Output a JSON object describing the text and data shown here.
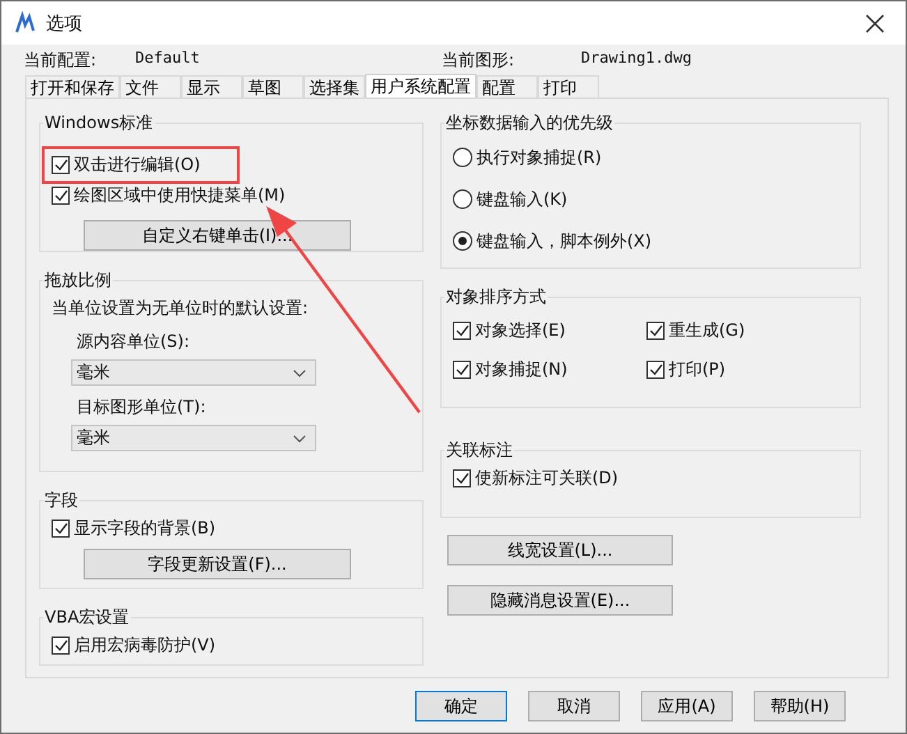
{
  "window": {
    "title": "选项"
  },
  "info": [
    {
      "label": "当前配置:",
      "value": "Default"
    },
    {
      "label": "当前图形:",
      "value": "Drawing1.dwg"
    }
  ],
  "tabs": [
    {
      "label": "打开和保存",
      "selected": false
    },
    {
      "label": "文件",
      "selected": false
    },
    {
      "label": "显示",
      "selected": false
    },
    {
      "label": "草图",
      "selected": false
    },
    {
      "label": "选择集",
      "selected": false
    },
    {
      "label": "用户系统配置",
      "selected": true
    },
    {
      "label": "配置",
      "selected": false
    },
    {
      "label": "打印",
      "selected": false
    }
  ],
  "columns": [
    {
      "groups": [
        {
          "title": "Windows标准",
          "items": [
            {
              "kind": "checkbox",
              "label": "双击进行编辑(O)",
              "checked": true
            },
            {
              "kind": "checkbox",
              "label": "绘图区域中使用快捷菜单(M)",
              "checked": true
            },
            {
              "kind": "button",
              "label": "自定义右键单击(I)..."
            }
          ]
        },
        {
          "title": "拖放比例",
          "items": [
            {
              "kind": "text",
              "label": "当单位设置为无单位时的默认设置:"
            },
            {
              "kind": "sublabel",
              "label": "源内容单位(S):"
            },
            {
              "kind": "select",
              "value": "毫米"
            },
            {
              "kind": "sublabel",
              "label": "目标图形单位(T):"
            },
            {
              "kind": "select",
              "value": "毫米"
            }
          ]
        },
        {
          "title": "字段",
          "items": [
            {
              "kind": "checkbox",
              "label": "显示字段的背景(B)",
              "checked": true
            },
            {
              "kind": "button",
              "label": "字段更新设置(F)..."
            }
          ]
        },
        {
          "title": "VBA宏设置",
          "items": [
            {
              "kind": "checkbox",
              "label": "启用宏病毒防护(V)",
              "checked": true
            }
          ]
        }
      ]
    },
    {
      "groups": [
        {
          "title": "坐标数据输入的优先级",
          "items": [
            {
              "kind": "radio",
              "label": "执行对象捕捉(R)",
              "selected": false
            },
            {
              "kind": "radio",
              "label": "键盘输入(K)",
              "selected": false
            },
            {
              "kind": "radio",
              "label": "键盘输入，脚本例外(X)",
              "selected": true
            }
          ]
        },
        {
          "title": "对象排序方式",
          "two_column": true,
          "items": [
            {
              "kind": "checkbox",
              "label": "对象选择(E)",
              "checked": true
            },
            {
              "kind": "checkbox",
              "label": "重生成(G)",
              "checked": true
            },
            {
              "kind": "checkbox",
              "label": "对象捕捉(N)",
              "checked": true
            },
            {
              "kind": "checkbox",
              "label": "打印(P)",
              "checked": true
            }
          ]
        },
        {
          "title": "关联标注",
          "items": [
            {
              "kind": "checkbox",
              "label": "使新标注可关联(D)",
              "checked": true
            }
          ]
        }
      ],
      "buttons": [
        "线宽设置(L)...",
        "隐藏消息设置(E)..."
      ]
    }
  ],
  "footer_buttons": [
    {
      "label": "确定",
      "default": true
    },
    {
      "label": "取消",
      "default": false
    },
    {
      "label": "应用(A)",
      "default": false
    },
    {
      "label": "帮助(H)",
      "default": false
    }
  ],
  "annotations": {
    "highlight": true,
    "arrow": true
  }
}
